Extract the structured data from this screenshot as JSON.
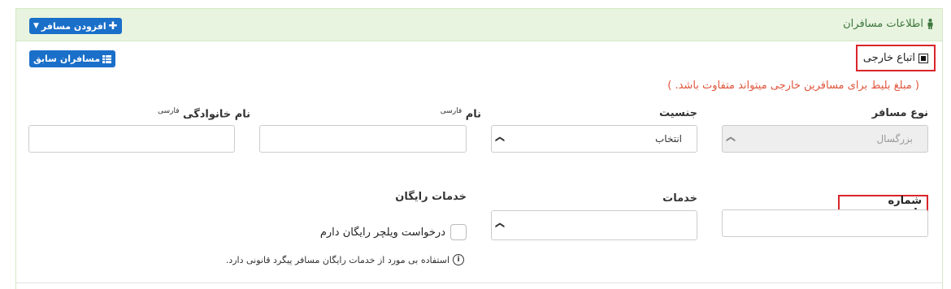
{
  "panel": {
    "title": "اطلاعات مسافران",
    "add_passenger_button": "افزودن مسافر",
    "previous_passengers_button": "مسافران سابق"
  },
  "foreign": {
    "label": "اتباع خارجی",
    "checked": true
  },
  "note": "( مبلغ بلیط برای مسافرین خارجی میتواند متفاوت باشد. )",
  "fields": {
    "passenger_type": {
      "label": "نوع مسافر",
      "value": "بزرگسال"
    },
    "gender": {
      "label": "جنسیت",
      "value": "انتخاب"
    },
    "first_name": {
      "label": "نام",
      "suffix": "فارسی",
      "value": ""
    },
    "last_name": {
      "label": "نام خانوادگی",
      "suffix": "فارسی",
      "value": ""
    },
    "passport": {
      "label": "شماره پاسپورت",
      "value": ""
    },
    "services": {
      "label": "خدمات",
      "value": ""
    },
    "free_services": {
      "label": "خدمات رایگان"
    }
  },
  "wheelchair": {
    "label": "درخواست ویلچر رایگان دارم",
    "checked": false
  },
  "info": "استفاده بی مورد از خدمات رایگان مسافر پیگرد قانونی دارد.",
  "colors": {
    "accent": "#1a6fc9",
    "highlight": "#d9252a",
    "note": "#e0553d",
    "header_bg": "#e8f4df"
  }
}
